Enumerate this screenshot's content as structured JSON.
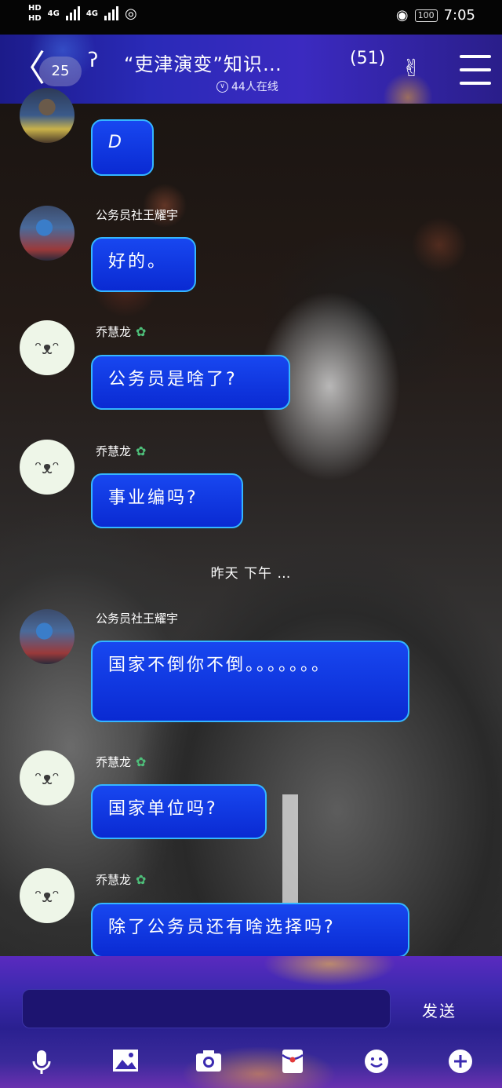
{
  "status_bar": {
    "hd1": "HD",
    "hd2": "HD",
    "net1": "4G",
    "net2": "4G",
    "battery": "100",
    "time": "7:05"
  },
  "header": {
    "unread_count": "25",
    "title": "“吏津演变”知识…",
    "member_count": "(51)",
    "online_status": "44人在线"
  },
  "messages": [
    {
      "sender": "",
      "text": "D"
    },
    {
      "sender": "公务员社王耀宇",
      "text": "好的。"
    },
    {
      "sender": "乔慧龙",
      "text": "公务员是啥了?"
    },
    {
      "sender": "乔慧龙",
      "text": "事业编吗?"
    },
    {
      "sender": "公务员社王耀宇",
      "text": "国家不倒你不倒。。。。。。。"
    },
    {
      "sender": "乔慧龙",
      "text": "国家单位吗?"
    },
    {
      "sender": "乔慧龙",
      "text": "除了公务员还有啥选择吗?"
    }
  ],
  "time_divider": "昨天 下午 …",
  "input": {
    "value": "",
    "send_label": "发送"
  },
  "icons": {
    "back": "chevron-left-icon",
    "ear": "ear-icon",
    "hand": "hand-gesture-icon",
    "menu": "menu-icon",
    "mic": "mic-icon",
    "image": "image-icon",
    "camera": "camera-icon",
    "red_packet": "red-packet-icon",
    "emoji": "emoji-icon",
    "plus": "plus-icon"
  },
  "colors": {
    "bubble": "#1847f0",
    "bubble_border": "#34b6ff",
    "header": "#2a2ab8"
  }
}
